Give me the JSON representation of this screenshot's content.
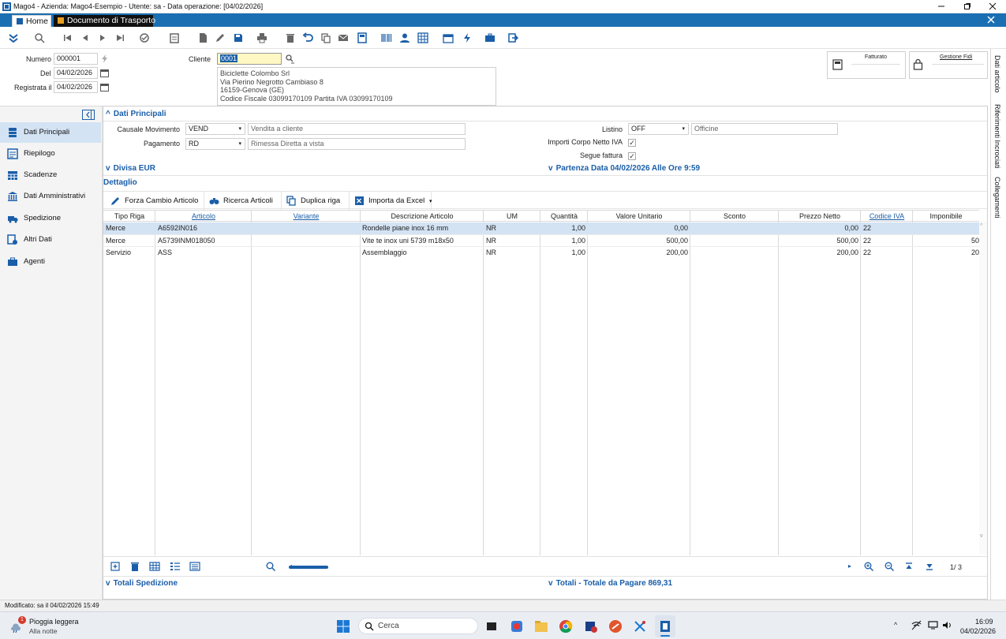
{
  "window": {
    "title": "Mago4 - Azienda: Mago4-Esempio - Utente: sa - Data operazione: [04/02/2026]"
  },
  "tabs": [
    {
      "label": "Home"
    },
    {
      "label": "Documento di Trasporto"
    }
  ],
  "header": {
    "numero_label": "Numero",
    "numero_value": "000001",
    "del_label": "Del",
    "del_value": "04/02/2026",
    "registrata_label": "Registrata il",
    "registrata_value": "04/02/2026",
    "cliente_label": "Cliente",
    "cliente_value": "0001",
    "address": [
      "Biciclette Colombo Srl",
      "Via Pierino Negrotto Cambiaso 8",
      "16159-Genova (GE)",
      "Codice Fiscale 03099170109 Partita IVA 03099170109"
    ],
    "fatturato_label": "Fatturato",
    "gestione_fidi_label": "Gestione Fidi"
  },
  "right_strip": [
    "Dati articolo",
    "Riferimenti Incrociati",
    "Collegamenti"
  ],
  "sidebar": {
    "items": [
      {
        "label": "Dati Principali",
        "icon": "document-stack-icon"
      },
      {
        "label": "Riepilogo",
        "icon": "summary-icon"
      },
      {
        "label": "Scadenze",
        "icon": "calendar-icon"
      },
      {
        "label": "Dati Amministrativi",
        "icon": "bank-icon"
      },
      {
        "label": "Spedizione",
        "icon": "truck-icon"
      },
      {
        "label": "Altri Dati",
        "icon": "settings-doc-icon"
      },
      {
        "label": "Agenti",
        "icon": "agent-icon"
      }
    ]
  },
  "dati_principali": {
    "title": "Dati Principali",
    "causale_label": "Causale Movimento",
    "causale_code": "VEND",
    "causale_desc": "Vendita a cliente",
    "pagamento_label": "Pagamento",
    "pagamento_code": "RD",
    "pagamento_desc": "Rimessa Diretta a vista",
    "listino_label": "Listino",
    "listino_code": "OFF",
    "listino_desc": "Officine",
    "importi_label": "Importi Corpo Netto IVA",
    "segue_label": "Segue fattura",
    "divisa": "Divisa EUR",
    "partenza": "Partenza Data 04/02/2026 Alle Ore 9:59"
  },
  "dettaglio": {
    "title": "Dettaglio",
    "buttons": [
      {
        "label": "Forza Cambio Articolo"
      },
      {
        "label": "Ricerca Articoli"
      },
      {
        "label": "Duplica riga"
      },
      {
        "label": "Importa da Excel"
      }
    ],
    "columns": [
      "Tipo Riga",
      "Articolo",
      "Variante",
      "Descrizione Articolo",
      "UM",
      "Quantità",
      "Valore Unitario",
      "Sconto",
      "Prezzo Netto",
      "Codice IVA",
      "Imponibile"
    ],
    "rows": [
      {
        "tipo": "Merce",
        "articolo": "A6592IN016",
        "variante": "",
        "descrizione": "Rondelle piane inox 16 mm",
        "um": "NR",
        "quantita": "1,00",
        "valore": "0,00",
        "sconto": "",
        "prezzo": "0,00",
        "iva": "22",
        "imponibile": ""
      },
      {
        "tipo": "Merce",
        "articolo": "A5739INM018050",
        "variante": "",
        "descrizione": "Vite te inox uni 5739 m18x50",
        "um": "NR",
        "quantita": "1,00",
        "valore": "500,00",
        "sconto": "",
        "prezzo": "500,00",
        "iva": "22",
        "imponibile": "50"
      },
      {
        "tipo": "Servizio",
        "articolo": "ASS",
        "variante": "",
        "descrizione": "Assemblaggio",
        "um": "NR",
        "quantita": "1,00",
        "valore": "200,00",
        "sconto": "",
        "prezzo": "200,00",
        "iva": "22",
        "imponibile": "20"
      }
    ],
    "page_indicator": "1/ 3"
  },
  "totali_spedizione": "Totali Spedizione",
  "totali_pagare": "Totali - Totale da Pagare 869,31",
  "status": "Modificato: sa il 04/02/2026 15:49",
  "taskbar": {
    "weather_title": "Pioggia leggera",
    "weather_sub": "Alla notte",
    "badge": "1",
    "search": "Cerca",
    "time": "16:09",
    "date": "04/02/2026"
  },
  "colors": {
    "accent": "#1a5ea8",
    "tabbar": "#1a6fb3",
    "selection": "#d3e3f4"
  }
}
